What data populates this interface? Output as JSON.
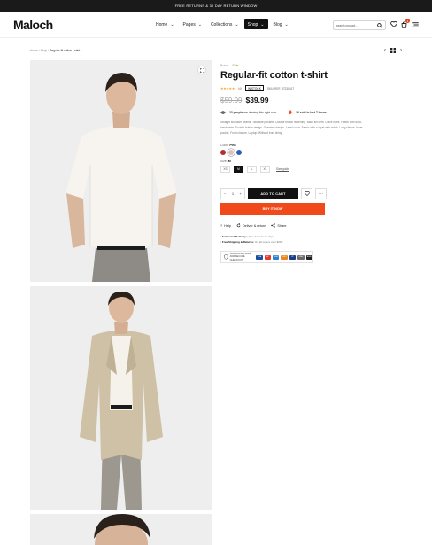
{
  "announcement": "FREE RETURNS & 30 DAY RETURN WINDOW",
  "brand": "Maloch",
  "nav": [
    {
      "label": "Home"
    },
    {
      "label": "Pages"
    },
    {
      "label": "Collections"
    },
    {
      "label": "Shop"
    },
    {
      "label": "Blog"
    }
  ],
  "search": {
    "placeholder": "search product..."
  },
  "cart_count": "1",
  "breadcrumb": {
    "home": "Home",
    "sep": "/",
    "section": "Shop",
    "current": "Regular-fit cotton t-shirt"
  },
  "product": {
    "brand_label": "Brand",
    "stock_tag": "Sale",
    "title": "Regular-fit cotton t-shirt",
    "stars": "★★★★★",
    "reviews": "(4)",
    "stock_badge": "IN STOCK",
    "sku": "SKU: REF. 47230417",
    "old_price": "$59.99",
    "price": "$39.99",
    "viewers": "23 people",
    "viewers_suffix": "are viewing this right now",
    "sold": "36 sold in last 7 hours",
    "description": "Straight shoulder seams. Two side pockets. Double button fastening. Back slit vent. Office rules. Fabric with wool, handmade. Double button design. Overstep design. Lapel collar. Fabric with a lapel with notch. Long sleeve. Inner pocket. Front closure. Laptop. Without front lining.",
    "color_label": "Color:",
    "color_value": "Pink",
    "swatches": [
      "#b1302f",
      "#dcc0bd",
      "#2a5fb8"
    ],
    "size_label": "Size:",
    "size_value": "M",
    "sizes": [
      "XS",
      "M",
      "L",
      "XL"
    ],
    "size_guide": "Size guide",
    "qty": "1",
    "add_to_cart": "ADD TO CART",
    "buy_now": "BUY IT NOW",
    "help": "Help",
    "delivery_return": "Deliver & return",
    "share": "Share",
    "delivery_line1_b": "Estimated Delivery:",
    "delivery_line1": "Up to 4 business days",
    "delivery_line2_b": "Free Shipping & Returns:",
    "delivery_line2": "On all orders over $200",
    "pay_text": "GUARANTEE SAFE AND SECURE CHECKOUT"
  },
  "payment_cards": [
    {
      "name": "VISA",
      "color": "#1a4ea2"
    },
    {
      "name": "MC",
      "color": "#e23b2b"
    },
    {
      "name": "AMEX",
      "color": "#2d7fd0"
    },
    {
      "name": "DISC",
      "color": "#e68a1f"
    },
    {
      "name": "PP",
      "color": "#1d3c8c"
    },
    {
      "name": "GPAY",
      "color": "#6b6b6b"
    },
    {
      "name": "APAY",
      "color": "#222222"
    }
  ]
}
